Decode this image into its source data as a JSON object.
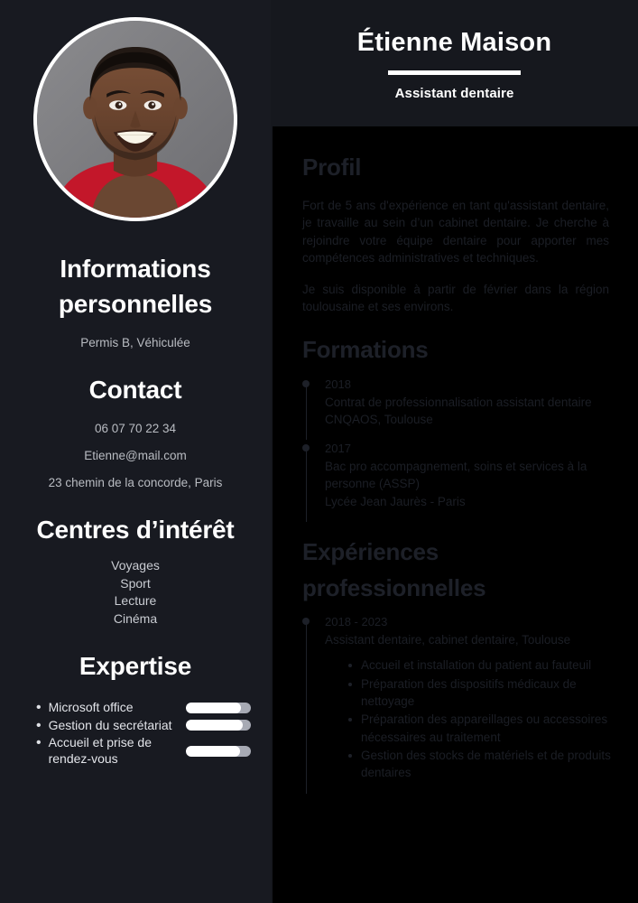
{
  "header": {
    "name": "Étienne Maison",
    "role": "Assistant dentaire"
  },
  "sidebar": {
    "photo_alt": "portrait-photo",
    "personal_info": {
      "title": "Informations personnelles",
      "detail": "Permis B, Véhiculée"
    },
    "contact": {
      "title": "Contact",
      "phone": "06 07 70 22 34",
      "email": "Etienne@mail.com",
      "address": "23 chemin de la concorde, Paris"
    },
    "interests": {
      "title": "Centres d’intérêt",
      "items": [
        "Voyages",
        "Sport",
        "Lecture",
        "Cinéma"
      ]
    },
    "expertise": {
      "title": "Expertise",
      "skills": [
        {
          "label": "Microsoft office",
          "level": 85
        },
        {
          "label": "Gestion du secrétariat",
          "level": 87
        },
        {
          "label": "Accueil et prise de rendez-vous",
          "level": 84
        }
      ]
    }
  },
  "main": {
    "profile": {
      "title": "Profil",
      "paragraph1": "Fort de 5 ans d'expérience en tant qu'assistant dentaire, je travaille au sein d’un cabinet dentaire. Je cherche à rejoindre votre équipe dentaire pour apporter mes compétences administratives et techniques.",
      "paragraph2": "Je suis disponible à partir de février dans la région toulousaine et ses environs."
    },
    "education": {
      "title": "Formations",
      "items": [
        {
          "year": "2018",
          "degree": "Contrat de professionnalisation assistant dentaire",
          "school": "CNQAOS, Toulouse"
        },
        {
          "year": "2017",
          "degree": "Bac pro accompagnement, soins et services à la personne (ASSP)",
          "school": "Lycée Jean Jaurès - Paris"
        }
      ]
    },
    "experience": {
      "title": "Expériences professionnelles",
      "items": [
        {
          "year": "2018 - 2023",
          "position": "Assistant dentaire, cabinet dentaire, Toulouse",
          "bullets": [
            "Accueil et installation du patient au fauteuil",
            "Préparation des dispositifs médicaux de nettoyage",
            "Préparation des appareillages ou accessoires nécessaires au traitement",
            "Gestion des stocks de matériels et de produits dentaires"
          ]
        }
      ]
    }
  },
  "colors": {
    "sidebar_bg": "#181a21",
    "page_bg": "#16181e",
    "panel_bg": "#000000",
    "accent_white": "#ffffff",
    "muted_text": "#b9bcc2",
    "panel_text": "#1b1e25"
  }
}
